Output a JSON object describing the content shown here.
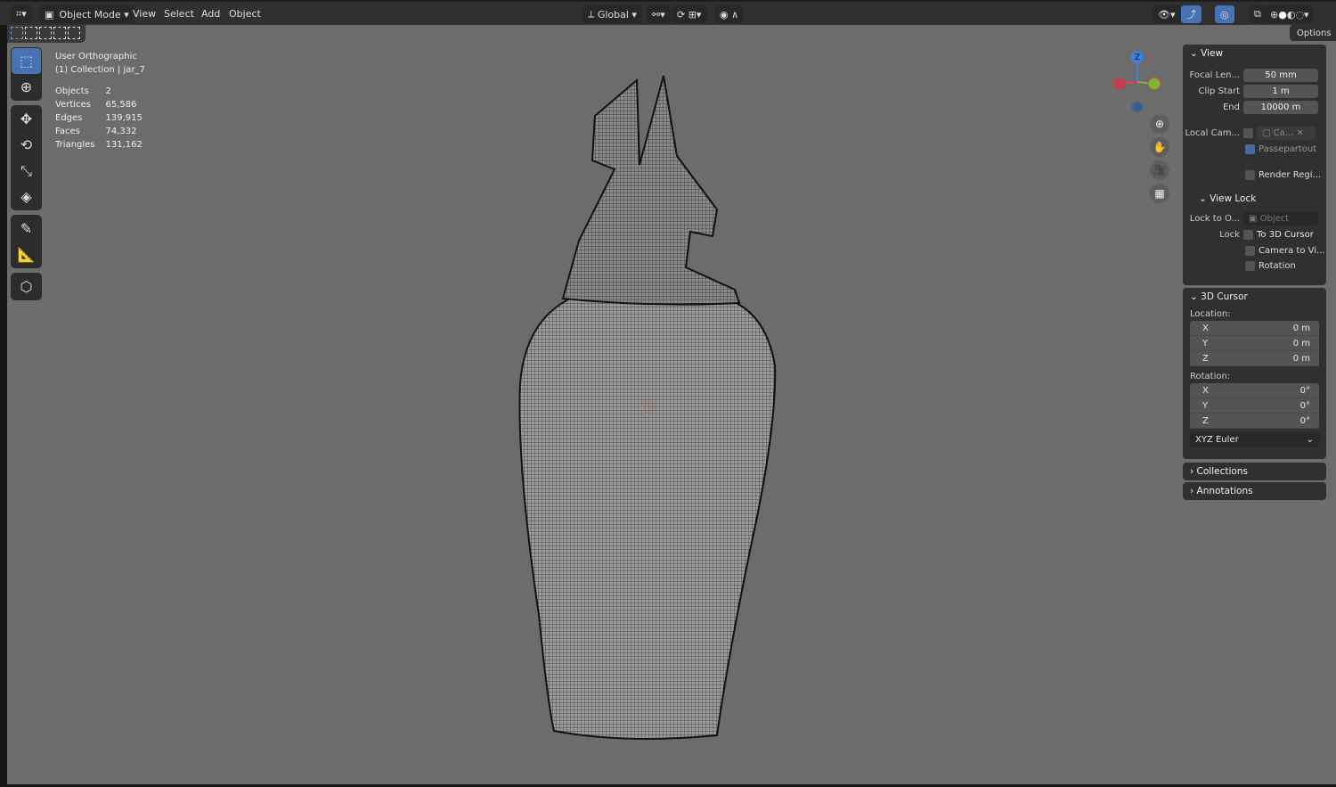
{
  "header": {
    "mode": "Object Mode",
    "menus": [
      "View",
      "Select",
      "Add",
      "Object"
    ],
    "orientation": "Global"
  },
  "options_label": "Options",
  "overlay": {
    "view_name": "User Orthographic",
    "collection": "(1) Collection | jar_7",
    "stats": [
      {
        "label": "Objects",
        "value": "2"
      },
      {
        "label": "Vertices",
        "value": "65,586"
      },
      {
        "label": "Edges",
        "value": "139,915"
      },
      {
        "label": "Faces",
        "value": "74,332"
      },
      {
        "label": "Triangles",
        "value": "131,162"
      }
    ]
  },
  "gizmo": {
    "z_label": "Z"
  },
  "view_panel": {
    "title": "View",
    "focal_label": "Focal Len...",
    "focal": "50 mm",
    "clip_start_label": "Clip Start",
    "clip_start": "1 m",
    "end_label": "End",
    "end": "10000 m",
    "local_cam_label": "Local Cam...",
    "local_cam_value": "Ca...",
    "passepartout": "Passepartout",
    "render_region": "Render Regi...",
    "view_lock": {
      "title": "View Lock",
      "lock_to_label": "Lock to O...",
      "lock_to_placeholder": "Object",
      "lock_label": "Lock",
      "to_cursor": "To 3D Cursor",
      "camera_to_view": "Camera to Vi...",
      "rotation": "Rotation"
    }
  },
  "cursor_panel": {
    "title": "3D Cursor",
    "location_label": "Location:",
    "location": [
      {
        "axis": "X",
        "value": "0 m"
      },
      {
        "axis": "Y",
        "value": "0 m"
      },
      {
        "axis": "Z",
        "value": "0 m"
      }
    ],
    "rotation_label": "Rotation:",
    "rotation": [
      {
        "axis": "X",
        "value": "0°"
      },
      {
        "axis": "Y",
        "value": "0°"
      },
      {
        "axis": "Z",
        "value": "0°"
      }
    ],
    "rotation_mode": "XYZ Euler"
  },
  "collapsed_panels": [
    "Collections",
    "Annotations"
  ]
}
